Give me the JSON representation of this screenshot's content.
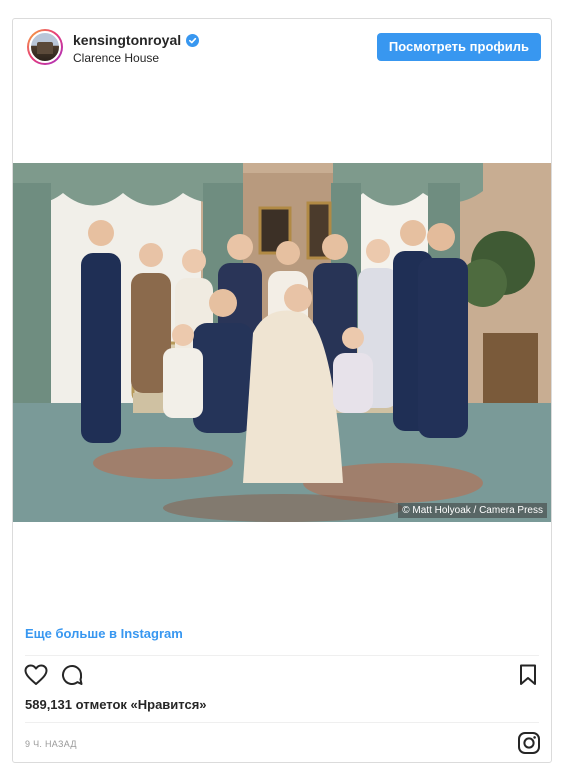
{
  "post": {
    "username": "kensingtonroyal",
    "location": "Clarence House",
    "profile_button": "Посмотреть профиль",
    "photo_credit": "© Matt Holyoak / Camera Press",
    "more_link": "Еще больше в Instagram",
    "likes_text": "589,131 отметок «Нравится»",
    "time_ago": "9 Ч. НАЗАД"
  },
  "icons": {
    "verified": "verified-badge-icon",
    "like": "heart-icon",
    "comment": "comment-icon",
    "save": "bookmark-icon",
    "brand": "instagram-logo-icon"
  },
  "colors": {
    "accent": "#3897f0",
    "border": "#dbdbdb",
    "text": "#262626",
    "muted": "#999999"
  }
}
